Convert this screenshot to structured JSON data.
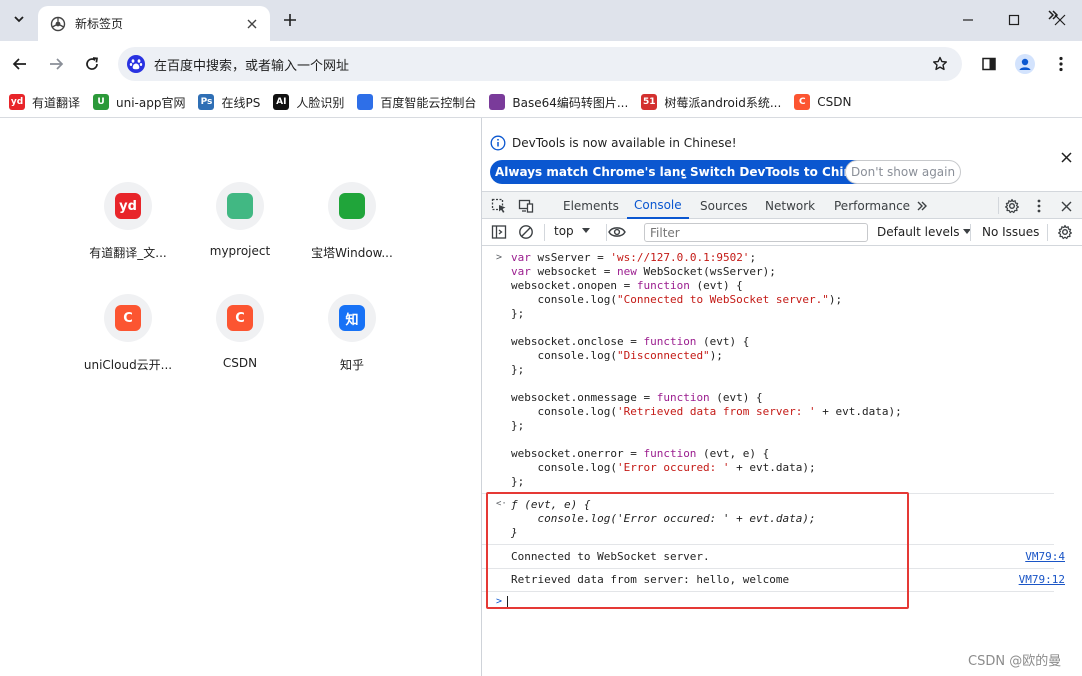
{
  "browser": {
    "tab": {
      "title": "新标签页",
      "icon": "chrome-newtab-icon"
    },
    "window_controls": [
      "minimize-icon",
      "maximize-icon",
      "close-icon"
    ],
    "omnibox": {
      "text": "在百度中搜索，或者输入一个网址",
      "engine_icon": "baidu-paw-icon"
    },
    "bookmarks": [
      {
        "label": "有道翻译",
        "icon_text": "yd",
        "color": "#e8252a"
      },
      {
        "label": "uni-app官网",
        "icon_text": "U",
        "color": "#2b9939"
      },
      {
        "label": "在线PS",
        "icon_text": "Ps",
        "color": "#2f6fb5"
      },
      {
        "label": "人脸识别",
        "icon_text": "AI",
        "color": "#111111"
      },
      {
        "label": "百度智能云控制台",
        "icon_text": "",
        "color": "#2e6fe8"
      },
      {
        "label": "Base64编码转图片...",
        "icon_text": "",
        "color": "#7a3b9a"
      },
      {
        "label": "树莓派android系统...",
        "icon_text": "51",
        "color": "#d3302f"
      },
      {
        "label": "CSDN",
        "icon_text": "C",
        "color": "#fc5531"
      }
    ]
  },
  "ntp": {
    "tiles": [
      {
        "label": "有道翻译_文...",
        "icon_text": "yd",
        "color": "#e8252a"
      },
      {
        "label": "myproject",
        "icon_text": "",
        "color": "#41b883"
      },
      {
        "label": "宝塔Window...",
        "icon_text": "",
        "color": "#20a53a"
      },
      {
        "label": "uniCloud云开...",
        "icon_text": "C",
        "color": "#fc5531"
      },
      {
        "label": "CSDN",
        "icon_text": "C",
        "color": "#fc5531"
      },
      {
        "label": "知乎",
        "icon_text": "知",
        "color": "#1772f6"
      }
    ]
  },
  "devtools": {
    "infobar": {
      "message": "DevTools is now available in Chinese!",
      "btn_match": "Always match Chrome's language",
      "btn_switch": "Switch DevTools to Chinese",
      "btn_dismiss": "Don't show again"
    },
    "tabs": [
      "Elements",
      "Console",
      "Sources",
      "Network",
      "Performance"
    ],
    "active_tab": "Console",
    "console_toolbar": {
      "context": "top",
      "filter_placeholder": "Filter",
      "levels": "Default levels",
      "issues": "No Issues"
    },
    "console": {
      "input_lines": [
        "var wsServer = 'ws://127.0.0.1:9502';",
        "var websocket = new WebSocket(wsServer);",
        "websocket.onopen = function (evt) {",
        "    console.log(\"Connected to WebSocket server.\");",
        "};",
        "",
        "websocket.onclose = function (evt) {",
        "    console.log(\"Disconnected\");",
        "};",
        "",
        "websocket.onmessage = function (evt) {",
        "    console.log('Retrieved data from server: ' + evt.data);",
        "};",
        "",
        "websocket.onerror = function (evt, e) {",
        "    console.log('Error occured: ' + evt.data);",
        "};"
      ],
      "result_lines": [
        "ƒ (evt, e) {",
        "    console.log('Error occured: ' + evt.data);",
        "}"
      ],
      "logs": [
        {
          "text": "Connected to WebSocket server.",
          "source": "VM79:4"
        },
        {
          "text": "Retrieved data from server: hello, welcome",
          "source": "VM79:12"
        }
      ]
    }
  },
  "watermark": "CSDN @欧的曼",
  "colors": {
    "accent": "#0b57d0",
    "highlight": "#e53935"
  }
}
